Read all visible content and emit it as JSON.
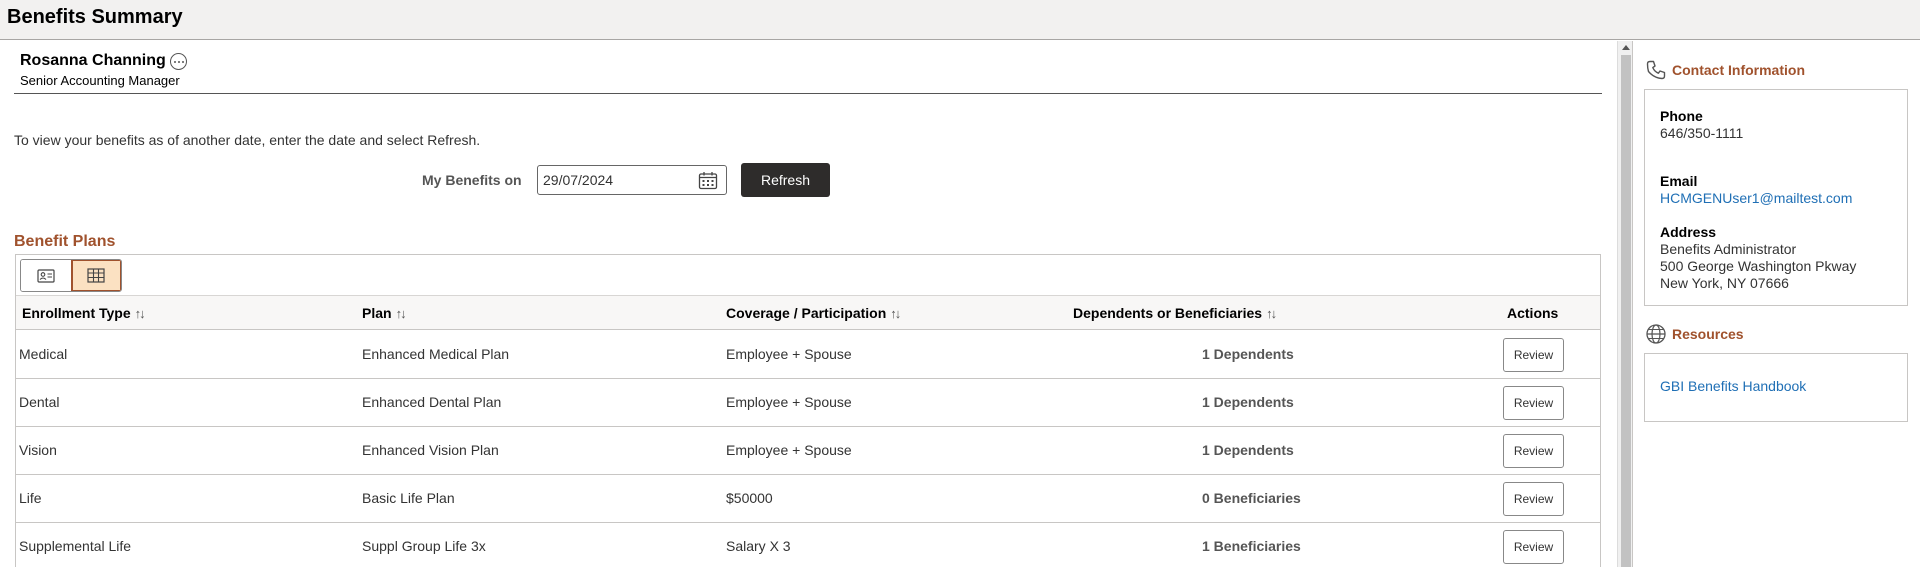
{
  "header": {
    "title": "Benefits Summary"
  },
  "person": {
    "name": "Rosanna Channing",
    "title": "Senior Accounting Manager"
  },
  "instructions": "To view your benefits as of another date, enter the date and select Refresh.",
  "date_filter": {
    "label": "My Benefits on",
    "value": "29/07/2024",
    "refresh_label": "Refresh"
  },
  "benefit_plans": {
    "title": "Benefit Plans",
    "columns": [
      "Enrollment Type",
      "Plan",
      "Coverage / Participation",
      "Dependents or Beneficiaries",
      "Actions"
    ],
    "sort_glyph": "↑↓",
    "rows": [
      {
        "type": "Medical",
        "plan": "Enhanced Medical Plan",
        "coverage": "Employee + Spouse",
        "dependents": "1 Dependents",
        "action": "Review"
      },
      {
        "type": "Dental",
        "plan": "Enhanced Dental Plan",
        "coverage": "Employee + Spouse",
        "dependents": "1 Dependents",
        "action": "Review"
      },
      {
        "type": "Vision",
        "plan": "Enhanced Vision Plan",
        "coverage": "Employee + Spouse",
        "dependents": "1 Dependents",
        "action": "Review"
      },
      {
        "type": "Life",
        "plan": "Basic Life Plan",
        "coverage": "$50000",
        "dependents": "0 Beneficiaries",
        "action": "Review"
      },
      {
        "type": "Supplemental Life",
        "plan": "Suppl Group Life 3x",
        "coverage": "Salary X 3",
        "dependents": "1 Beneficiaries",
        "action": "Review"
      }
    ]
  },
  "contact": {
    "title": "Contact Information",
    "phone_label": "Phone",
    "phone": "646/350-1111",
    "email_label": "Email",
    "email": "HCMGENUser1@mailtest.com",
    "address_label": "Address",
    "address": [
      "Benefits Administrator",
      "500 George Washington Pkway",
      "New York, NY 07666"
    ]
  },
  "resources": {
    "title": "Resources",
    "link": "GBI Benefits Handbook"
  },
  "icons": [
    "more-icon",
    "calendar-icon",
    "card-view-icon",
    "grid-view-icon",
    "phone-icon",
    "globe-icon",
    "sort-icon"
  ],
  "colors": {
    "accent": "#a0522d",
    "link": "#1f6fb5",
    "button_dark": "#2e2c2b",
    "toggle_active": "#fbe1c2"
  }
}
